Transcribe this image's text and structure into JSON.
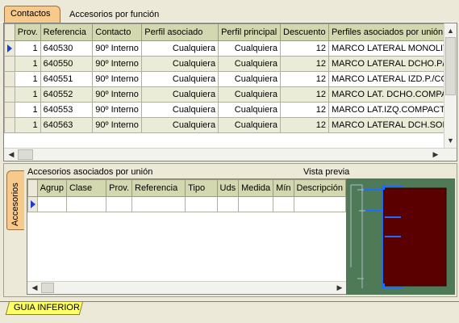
{
  "tabs": {
    "active": "Contactos",
    "inactive": "Accesorios por función"
  },
  "contacts_grid": {
    "columns": [
      "Prov.",
      "Referencia",
      "Contacto",
      "Perfil asociado",
      "Perfil principal",
      "Descuento",
      "Perfiles asociados por unión"
    ],
    "rows": [
      [
        "1",
        "640530",
        "90º Interno",
        "Cualquiera",
        "Cualquiera",
        "12",
        "MARCO LATERAL MONOLIT"
      ],
      [
        "1",
        "640550",
        "90º Interno",
        "Cualquiera",
        "Cualquiera",
        "12",
        "MARCO LATERAL DCHO.P/C"
      ],
      [
        "1",
        "640551",
        "90º Interno",
        "Cualquiera",
        "Cualquiera",
        "12",
        "MARCO LATERAL IZD.P./CO"
      ],
      [
        "1",
        "640552",
        "90º Interno",
        "Cualquiera",
        "Cualquiera",
        "12",
        "MARCO LAT. DCHO.COMPA"
      ],
      [
        "1",
        "640553",
        "90º Interno",
        "Cualquiera",
        "Cualquiera",
        "12",
        "MARCO LAT.IZQ.COMPACTO"
      ],
      [
        "1",
        "640563",
        "90º Interno",
        "Cualquiera",
        "Cualquiera",
        "12",
        "MARCO LATERAL DCH.SOLA"
      ]
    ]
  },
  "side_tab": {
    "label": "Accesorios"
  },
  "accessories": {
    "title": "Accesorios asociados por unión",
    "columns": [
      "Agrup",
      "Clase",
      "Prov.",
      "Referencia",
      "Tipo",
      "Uds",
      "Medida",
      "Mín",
      "Descripción"
    ]
  },
  "preview": {
    "title": "Vista previa"
  },
  "bottom_tab": {
    "label": "GUIA INFERIOR"
  },
  "colors": {
    "active_tab": "#f7c98a",
    "grid_header": "#d4d8b0",
    "preview_bg": "#4f7a57",
    "preview_shape": "#5a0000",
    "preview_lines": "#1e6bff",
    "bottom_tab": "#ffff66"
  }
}
